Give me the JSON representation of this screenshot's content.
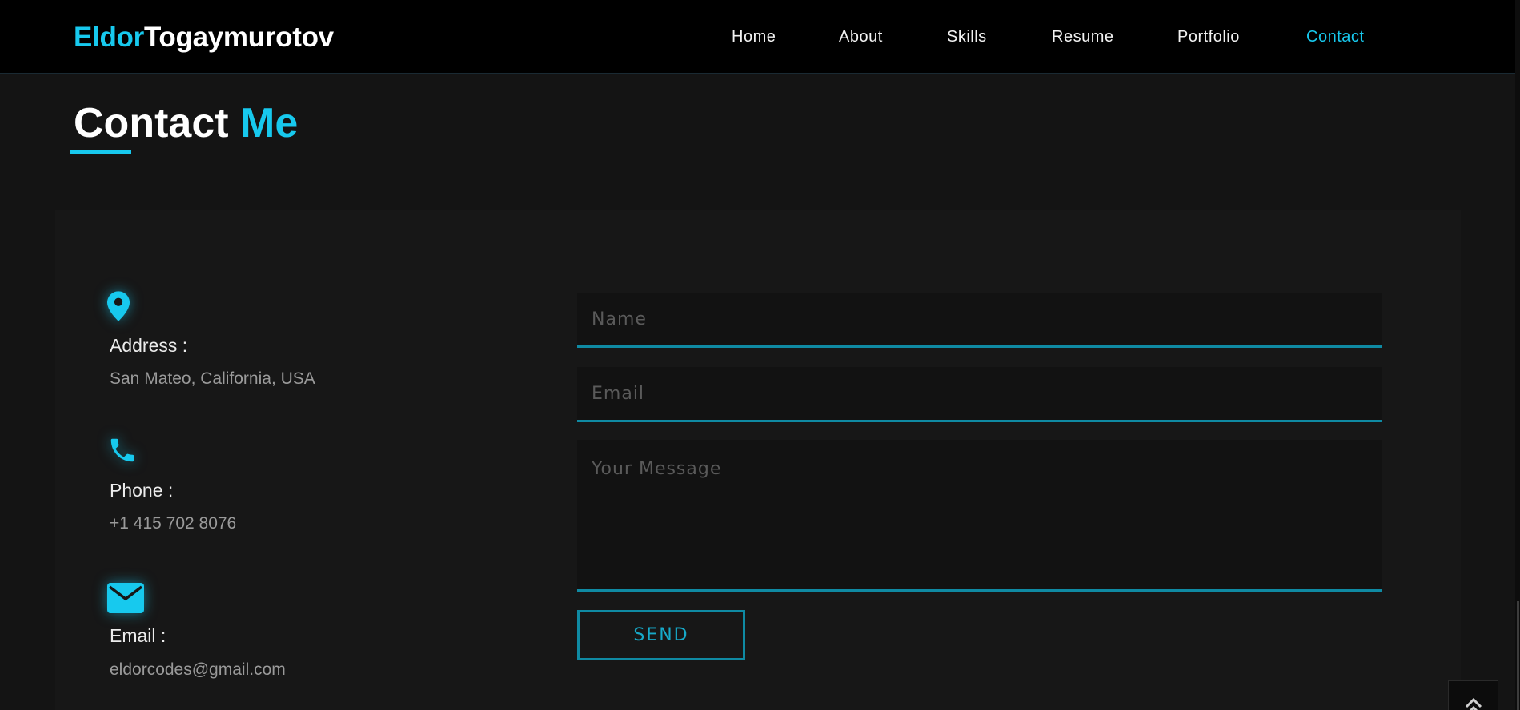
{
  "header": {
    "logo_first": "Eldor",
    "logo_last": "Togaymurotov",
    "nav": [
      {
        "label": "Home"
      },
      {
        "label": "About"
      },
      {
        "label": "Skills"
      },
      {
        "label": "Resume"
      },
      {
        "label": "Portfolio"
      },
      {
        "label": "Contact",
        "active": true
      }
    ]
  },
  "section": {
    "title_main": "Contact",
    "title_accent": "Me"
  },
  "contact_info": {
    "address": {
      "icon": "location-pin-icon",
      "label": "Address :",
      "value": "San Mateo, California, USA"
    },
    "phone": {
      "icon": "phone-icon",
      "label": "Phone :",
      "value": "+1 415 702 8076"
    },
    "email": {
      "icon": "envelope-icon",
      "label": "Email :",
      "value": "eldorcodes@gmail.com"
    }
  },
  "form": {
    "name_placeholder": "Name",
    "email_placeholder": "Email",
    "message_placeholder": "Your Message",
    "send_label": "SEND"
  },
  "colors": {
    "accent": "#17c9ee",
    "input_border": "#0f8aa3",
    "background": "#141414",
    "navbar": "#000000"
  }
}
